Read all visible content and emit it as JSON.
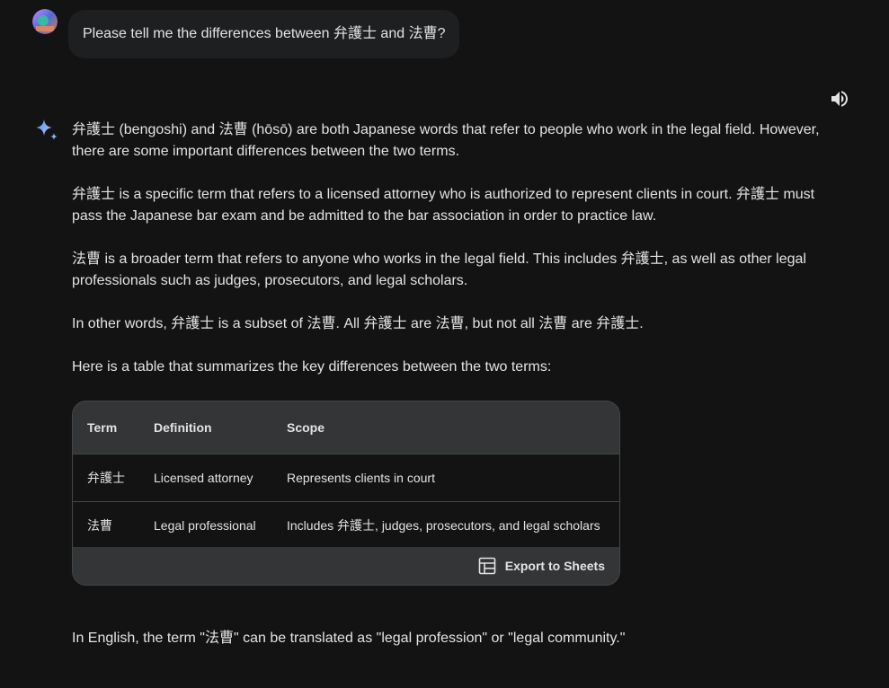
{
  "user_message": {
    "text": "Please tell me the differences between 弁護士 and 法曹?",
    "avatar_icon": "user-avatar-icon"
  },
  "controls": {
    "speaker_icon": "volume-icon"
  },
  "response": {
    "icon": "gemini-sparkle-icon",
    "paragraphs": [
      "弁護士 (bengoshi) and 法曹 (hōsō) are both Japanese words that refer to people who work in the legal field. However, there are some important differences between the two terms.",
      "弁護士 is a specific term that refers to a licensed attorney who is authorized to represent clients in court. 弁護士 must pass the Japanese bar exam and be admitted to the bar association in order to practice law.",
      "法曹 is a broader term that refers to anyone who works in the legal field. This includes 弁護士, as well as other legal professionals such as judges, prosecutors, and legal scholars.",
      "In other words, 弁護士 is a subset of 法曹. All 弁護士 are 法曹, but not all 法曹 are 弁護士.",
      "Here is a table that summarizes the key differences between the two terms:"
    ],
    "table": {
      "headers": [
        "Term",
        "Definition",
        "Scope"
      ],
      "rows": [
        [
          "弁護士",
          "Licensed attorney",
          "Represents clients in court"
        ],
        [
          "法曹",
          "Legal professional",
          "Includes 弁護士, judges, prosecutors, and legal scholars"
        ]
      ],
      "export_label": "Export to Sheets",
      "export_icon": "sheets-table-icon"
    },
    "closing": "In English, the term \"法曹\" can be translated as \"legal profession\" or \"legal community.\""
  },
  "colors": {
    "background": "#131314",
    "bubble": "#1e1f20",
    "table_header": "#333537",
    "text": "#e3e3e3",
    "accent_blue": "#8ab4f8"
  }
}
